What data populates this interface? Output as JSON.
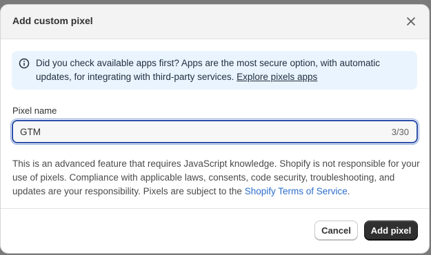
{
  "modal": {
    "title": "Add custom pixel",
    "close_icon": "close-icon"
  },
  "info": {
    "icon": "info-icon",
    "text": "Did you check available apps first? Apps are the most secure option, with automatic updates, for integrating with third-party services.",
    "link_text": "Explore pixels apps"
  },
  "field": {
    "label": "Pixel name",
    "value": "GTM",
    "counter": "3/30"
  },
  "description": {
    "text": "This is an advanced feature that requires JavaScript knowledge. Shopify is not responsible for your use of pixels. Compliance with applicable laws, consents, code security, troubleshooting, and updates are your responsibility. Pixels are subject to the",
    "link_text": "Shopify Terms of Service",
    "suffix": "."
  },
  "footer": {
    "cancel_label": "Cancel",
    "primary_label": "Add pixel"
  },
  "colors": {
    "info_bg": "#eaf4ff",
    "link_blue": "#2c6ecb",
    "primary_button": "#303030",
    "focus_border": "#2b4ea8"
  }
}
